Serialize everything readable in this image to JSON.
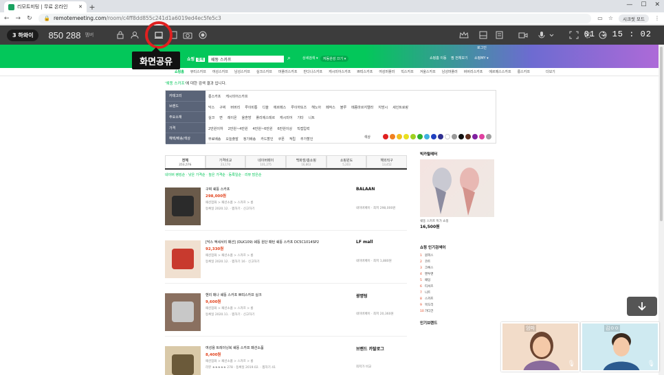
{
  "browser": {
    "tab_title": "리모트미팅 | 무료 온라인",
    "new_tab": "+",
    "url_host": "remotemeeting.com",
    "url_path": "/room/c4ff8dd855c241d1a6019ed4ec5fe5c3",
    "secret_mode": "시크릿 모드"
  },
  "meeting": {
    "participants_label": "3 하와이",
    "room_number": "850 288",
    "room_sub": "멤버",
    "timer": "01 : 15 : 02",
    "tooltip": "화면공유"
  },
  "page": {
    "search_logo": "쇼핑",
    "search_logo_badge": "검색",
    "search_query": "쉐뚱 스카프",
    "top_links": [
      "로그인"
    ],
    "gpill_left": "상세검색 ▾",
    "gpill_right": "자동완성 끄기 ▾",
    "gpill_far1": "쇼핑홈 이동",
    "gpill_far2": "찜 전체보기",
    "gpill_far3": "쇼핑MY ▾",
    "category_tabs": [
      "쇼핑홈",
      "뷰티스카프",
      "여성스카프",
      "남성스카프",
      "실크스카프",
      "머플러스카프",
      "반다나스카프",
      "캐시미어스카프",
      "쁘띠스카프",
      "여성머플러",
      "빅스카프",
      "겨울스카프",
      "남성머플러",
      "버버리스카프",
      "에르메스스카프",
      "롱스카프"
    ],
    "category_more": "더보기",
    "result_note_query": "'쉐뚱 스카프'",
    "result_note_rest": "에 대한 검색 결과 입니다.",
    "filter_left": [
      "카테고리",
      "브랜드",
      "주요소재",
      "가격",
      "혜택/배송/색상"
    ],
    "filter_rows": [
      [
        "롱스카프",
        "캐시미어스카프"
      ],
      [
        "닥스",
        "구찌",
        "버버리",
        "루이비통",
        "디올",
        "에르메스",
        "루이까또즈",
        "헤노아",
        "페작스",
        "블루",
        "메종마르지엘라",
        "지방시",
        "세인트로랑"
      ],
      [
        "실크",
        "면",
        "레이온",
        "울혼방",
        "폴리에스테르",
        "캐시미어",
        "기타",
        "니트"
      ],
      [
        "2만원이하",
        "2만원~4만원",
        "4만원~6만원",
        "6만원이상",
        "직접입력"
      ],
      [
        "무료배송",
        "오늘출발",
        "정기배송",
        "카드할인",
        "쿠폰",
        "적립",
        "추가할인"
      ]
    ],
    "color_label": "색상",
    "colors": [
      "#e02020",
      "#f08020",
      "#f0c020",
      "#e8e020",
      "#a0d020",
      "#30b030",
      "#40b0e0",
      "#2040c0",
      "#303090",
      "#ffffff",
      "#999999",
      "#111111",
      "#603020",
      "#8020a0",
      "#e040a0",
      "#a0a0a0"
    ],
    "product_tabs": [
      {
        "label": "전체",
        "count": "253,576"
      },
      {
        "label": "가격비교",
        "count": "23,170"
      },
      {
        "label": "네이버페이",
        "count": "101,275"
      },
      {
        "label": "백화점/홈쇼핑",
        "count": "16,863"
      },
      {
        "label": "쇼핑윈도",
        "count": "5,203"
      },
      {
        "label": "해외직구",
        "count": "13,452"
      }
    ],
    "sort_text": "네이버 랭킹순 · 낮은 가격순 · 높은 가격순 · 등록일순 · 리뷰 많은순",
    "products": [
      {
        "name": "구찌 쉐뚱 스카프",
        "price": "298,000원",
        "cat": "패션잡화 > 패션소품 > 스카프 > 롱",
        "meta": "등록일 2020.12. · 찜하기 · 신고하기",
        "mall": "BALAAN",
        "mall_sub": "네이버페이 · 최저 298,000원"
      },
      {
        "name": "[닥스 액세서리 패션] (DLK109) 쉐뚱 원단 패턴 쉐뚱 스카프 DC5C1014SP2",
        "price": "92,330원",
        "cat": "패션잡화 > 패션소품 > 스카프 > 롱",
        "meta": "등록일 2020.12. · 찜하기 16 · 신고하기",
        "mall": "LF mall",
        "mall_sub": "네이버페이 · 최저 1,880원"
      },
      {
        "name": "헨리 매나 쉐뚱 스카프 쁘띠스카프 실크",
        "price": "9,600원",
        "cat": "패션잡화 > 패션소품 > 스카프 > 롱",
        "meta": "등록일 2020.11. · 찜하기 · 신고하기",
        "mall": "광명텅",
        "mall_sub": "네이버페이 · 최저 20,360원"
      },
      {
        "name": "여성용 트레이닝복 쉐뚱 스카프 패션소품",
        "price": "8,400원",
        "cat": "패션잡화 > 패션소품 > 스카프 > 롱",
        "meta": "리뷰 ★★★★★ 278 · 등록일 2019.02. · 찜하기 41",
        "mall": "브랜드 카탈로그",
        "mall_sub": "최저가 비교"
      }
    ],
    "sidebar_ad_title": "빅카탈레터",
    "sidebar_ad_text": "쉐뚱 스카프 특가 쇼핑",
    "sidebar_ad_price": "16,500원",
    "sidebar_rank_title": "쇼핑 인기검색어",
    "sidebar_ranks": [
      "원피스",
      "코트",
      "크록스",
      "맨투맨",
      "패딩",
      "티셔츠",
      "니트",
      "스카프",
      "목도리",
      "가디건"
    ],
    "sidebar_brand_title": "인기브랜드"
  },
  "videos": [
    {
      "name": "엄마"
    },
    {
      "name": "김ㅇㅇ"
    }
  ]
}
